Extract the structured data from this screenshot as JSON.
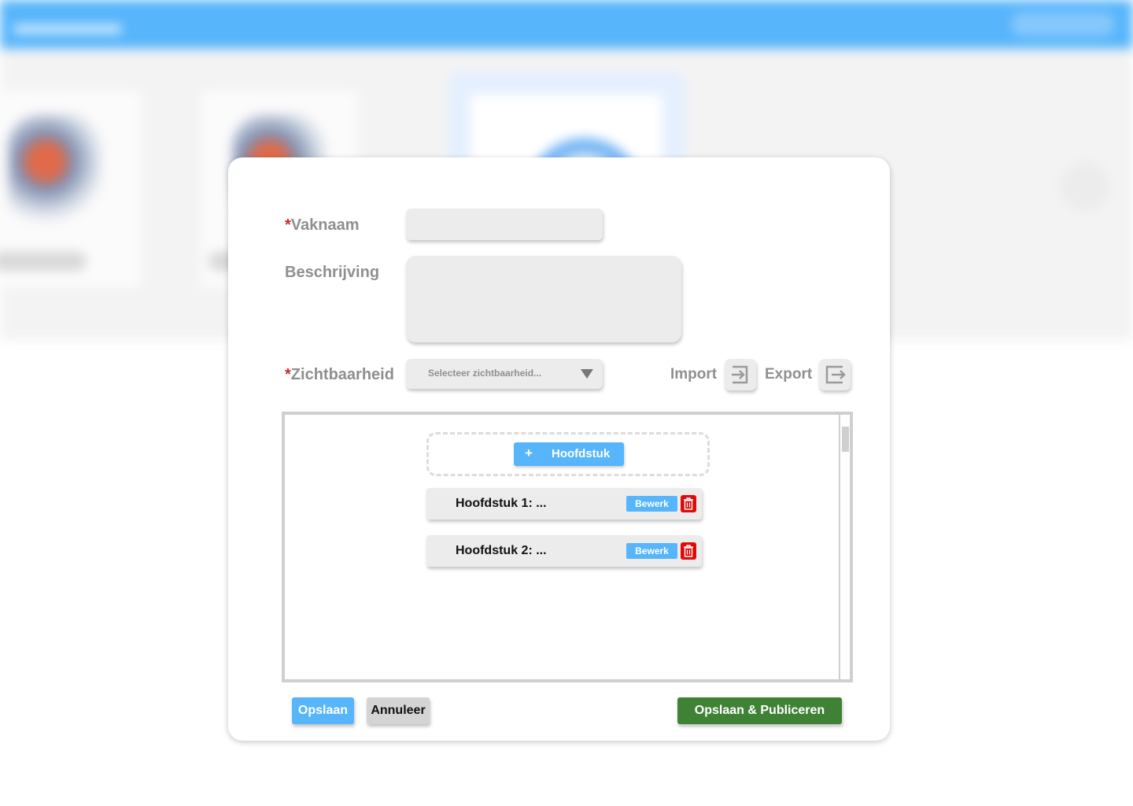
{
  "form": {
    "name_required_mark": "*",
    "name_label": "Vaknaam",
    "name_value": "",
    "description_label": "Beschrijving",
    "description_value": "",
    "visibility_required_mark": "*",
    "visibility_label": "Zichtbaarheid",
    "visibility_placeholder": "Selecteer zichtbaarheid..."
  },
  "io": {
    "import_label": "Import",
    "export_label": "Export"
  },
  "chapters": {
    "add_icon": "+",
    "add_label": "Hoofdstuk",
    "items": [
      {
        "title": "Hoofdstuk 1: ...",
        "edit_label": "Bewerk"
      },
      {
        "title": "Hoofdstuk 2: ...",
        "edit_label": "Bewerk"
      }
    ]
  },
  "actions": {
    "save_label": "Opslaan",
    "cancel_label": "Annuleer",
    "publish_label": "Opslaan & Publiceren"
  },
  "colors": {
    "accent_blue": "#57b5fb",
    "danger_red": "#e00a0a",
    "publish_green": "#3f8236",
    "required_red": "#d0262a"
  },
  "icons": {
    "import": "import-icon",
    "export": "export-icon",
    "delete": "trash-icon",
    "dropdown": "chevron-down-icon"
  }
}
